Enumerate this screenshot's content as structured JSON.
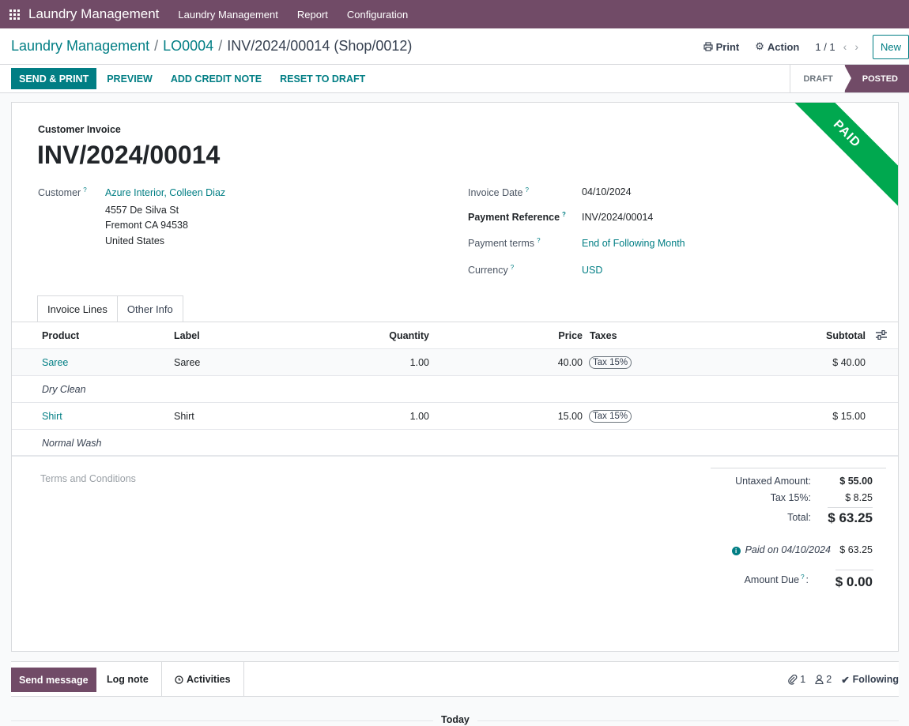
{
  "navbar": {
    "brand": "Laundry Management",
    "items": [
      "Laundry Management",
      "Report",
      "Configuration"
    ]
  },
  "breadcrumb": {
    "root": "Laundry Management",
    "order": "LO0004",
    "current": "INV/2024/00014 (Shop/0012)"
  },
  "control": {
    "print_label": "Print",
    "action_label": "Action",
    "pager": "1 / 1",
    "new_label": "New"
  },
  "actions": {
    "send_print": "SEND & PRINT",
    "preview": "PREVIEW",
    "add_credit_note": "ADD CREDIT NOTE",
    "reset_to_draft": "RESET TO DRAFT"
  },
  "stages": {
    "draft": "DRAFT",
    "posted": "POSTED",
    "active": "POSTED"
  },
  "ribbon": "PAID",
  "invoice": {
    "doc_type": "Customer Invoice",
    "name": "INV/2024/00014",
    "customer_label": "Customer",
    "customer_name": "Azure Interior, Colleen Diaz",
    "address_line1": "4557 De Silva St",
    "address_line2": "Fremont CA 94538",
    "address_line3": "United States",
    "invoice_date_label": "Invoice Date",
    "invoice_date": "04/10/2024",
    "payment_ref_label": "Payment Reference",
    "payment_ref": "INV/2024/00014",
    "payment_terms_label": "Payment terms",
    "payment_terms": "End of Following Month",
    "currency_label": "Currency",
    "currency": "USD"
  },
  "tabs": [
    "Invoice Lines",
    "Other Info"
  ],
  "table": {
    "headers": {
      "product": "Product",
      "label": "Label",
      "quantity": "Quantity",
      "price": "Price",
      "taxes": "Taxes",
      "subtotal": "Subtotal"
    },
    "rows": [
      {
        "product": "Saree",
        "label": "Saree",
        "quantity": "1.00",
        "price": "40.00",
        "tax": "Tax 15%",
        "subtotal": "$ 40.00",
        "note": "Dry Clean"
      },
      {
        "product": "Shirt",
        "label": "Shirt",
        "quantity": "1.00",
        "price": "15.00",
        "tax": "Tax 15%",
        "subtotal": "$ 15.00",
        "note": "Normal Wash"
      }
    ]
  },
  "terms_placeholder": "Terms and Conditions",
  "totals": {
    "untaxed_label": "Untaxed Amount:",
    "untaxed": "$ 55.00",
    "tax_label": "Tax 15%:",
    "tax": "$ 8.25",
    "total_label": "Total:",
    "total": "$ 63.25",
    "paid_on": "Paid on 04/10/2024",
    "paid_amount": "$ 63.25",
    "amount_due_label": "Amount Due",
    "amount_due_suffix": ":",
    "amount_due": "$ 0.00"
  },
  "chatter": {
    "send_message": "Send message",
    "log_note": "Log note",
    "activities": "Activities",
    "attachments": "1",
    "followers": "2",
    "following": "Following",
    "today": "Today"
  },
  "colors": {
    "brand": "#714b67",
    "accent": "#017e84",
    "paid": "#00a84f",
    "following": "#28a745"
  }
}
